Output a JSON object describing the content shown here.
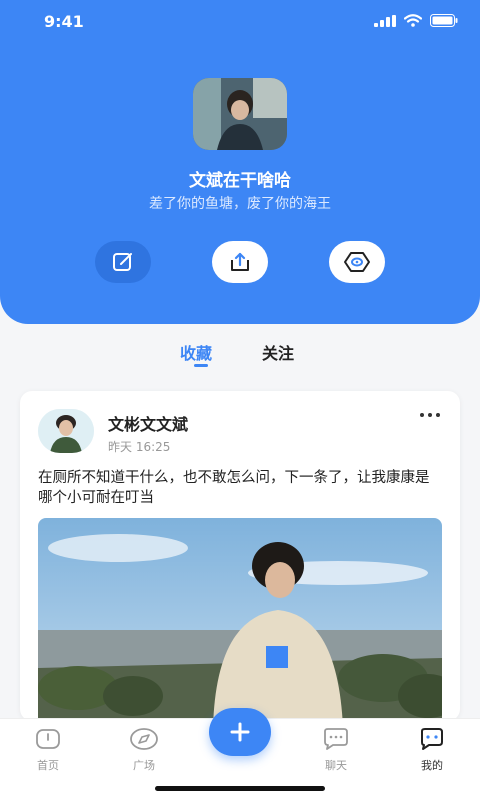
{
  "status_bar": {
    "time": "9:41"
  },
  "profile": {
    "name": "文斌在干啥哈",
    "bio": "差了你的鱼塘，废了你的海王"
  },
  "tabs": {
    "favorites": "收藏",
    "following": "关注"
  },
  "post": {
    "author": "文彬文文斌",
    "time": "昨天 16:25",
    "text": "在厕所不知道干什么，也不敢怎么问，下一条了，让我康康是哪个小可耐在叮当"
  },
  "tabbar": {
    "home": "首页",
    "square": "广场",
    "chat": "聊天",
    "mine": "我的"
  },
  "colors": {
    "accent": "#3d86f5"
  },
  "icons": [
    "edit-icon",
    "share-icon",
    "view-icon",
    "more-icon",
    "home-icon",
    "compass-icon",
    "plus-icon",
    "chat-icon",
    "profile-icon"
  ]
}
